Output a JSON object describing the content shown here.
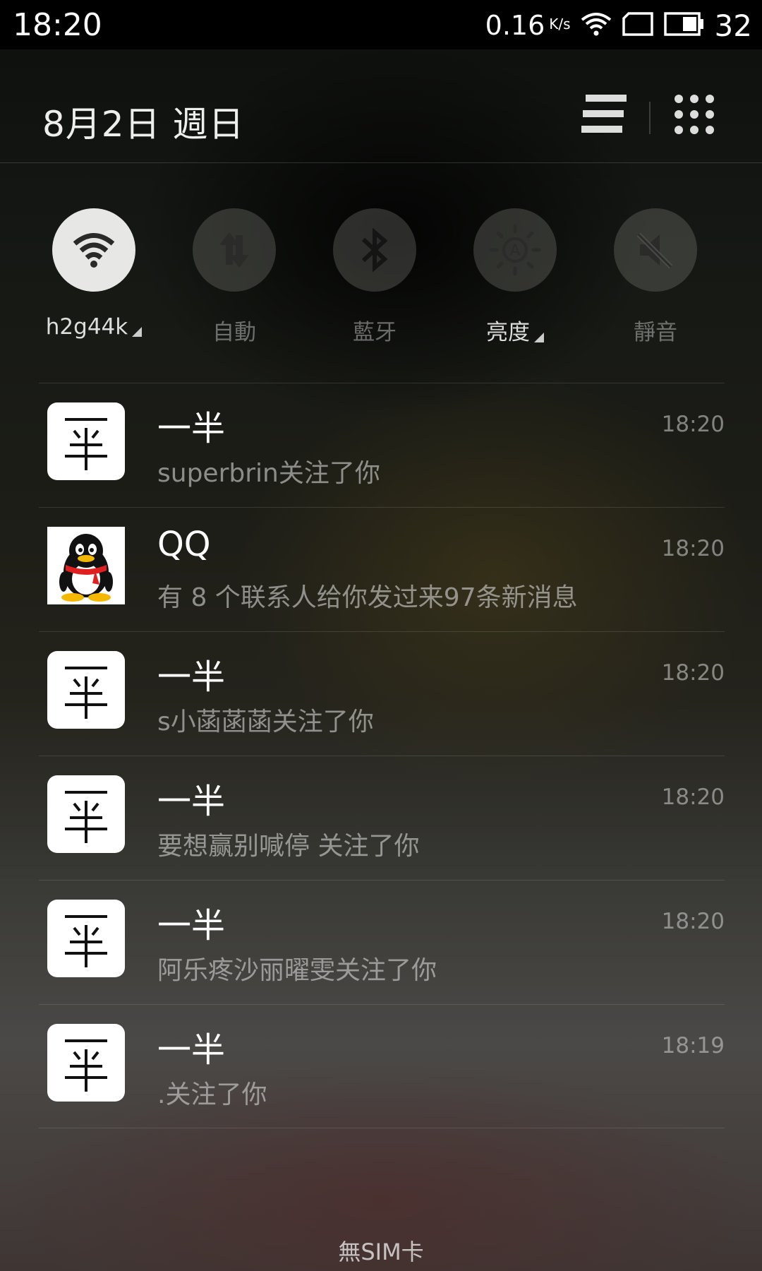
{
  "status_bar": {
    "time": "18:20",
    "net_speed": "0.16",
    "net_speed_unit": "K/s",
    "battery_level": "32"
  },
  "header": {
    "date": "8月2日  週日"
  },
  "toggles": [
    {
      "label": "h2g44k",
      "icon": "wifi-icon",
      "active": true
    },
    {
      "label": "自動",
      "icon": "data-arrows-icon",
      "active": false
    },
    {
      "label": "藍牙",
      "icon": "bluetooth-icon",
      "active": false
    },
    {
      "label": "亮度",
      "icon": "brightness-icon",
      "active": false
    },
    {
      "label": "靜音",
      "icon": "mute-icon",
      "active": false
    }
  ],
  "notifications": [
    {
      "app": "一半",
      "text": "superbrin关注了你",
      "time": "18:20",
      "icon": "yiban-app-icon"
    },
    {
      "app": "QQ",
      "text": "有 8 个联系人给你发过来97条新消息",
      "time": "18:20",
      "icon": "qq-penguin-icon"
    },
    {
      "app": "一半",
      "text": "s小菡菡菡关注了你",
      "time": "18:20",
      "icon": "yiban-app-icon"
    },
    {
      "app": "一半",
      "text": "要想赢别喊停  关注了你",
      "time": "18:20",
      "icon": "yiban-app-icon"
    },
    {
      "app": "一半",
      "text": "阿乐疼沙丽曜雯关注了你",
      "time": "18:20",
      "icon": "yiban-app-icon"
    },
    {
      "app": "一半",
      "text": ".关注了你",
      "time": "18:19",
      "icon": "yiban-app-icon"
    }
  ],
  "footer": {
    "carrier": "無SIM卡"
  },
  "colors": {
    "active_toggle_bg": "#e7e7e6",
    "inactive_toggle_bg": "#4a4a48"
  }
}
